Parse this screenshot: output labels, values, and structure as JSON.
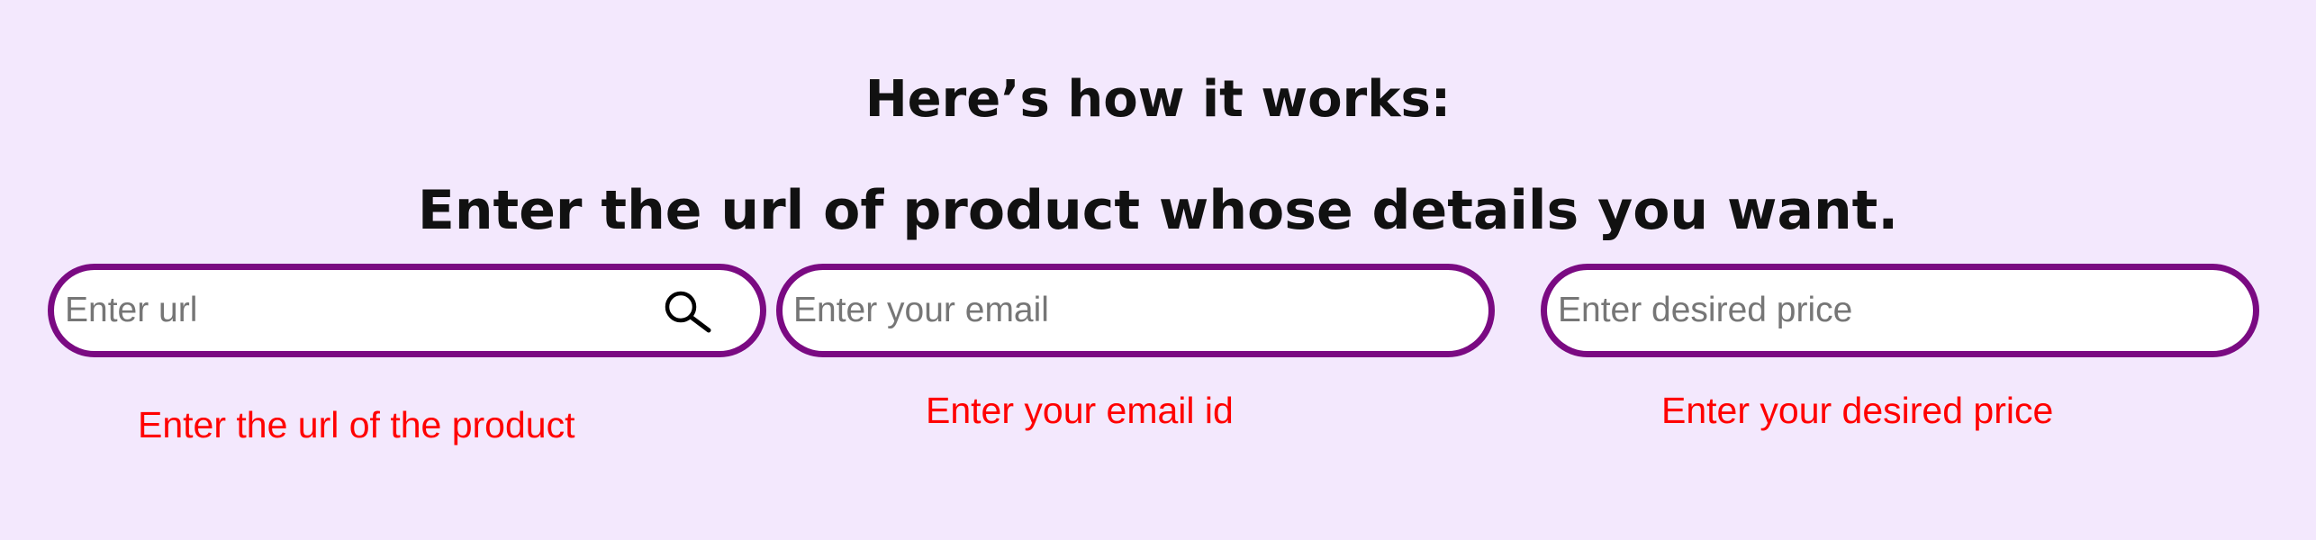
{
  "header": {
    "title": "Here’s how it works:",
    "instruction": "Enter the url of product whose details you want."
  },
  "fields": {
    "url": {
      "placeholder": "Enter url",
      "value": "",
      "icon": "search-icon",
      "error": "Enter the url of the product"
    },
    "email": {
      "placeholder": "Enter your email",
      "value": "",
      "error": "Enter your email id"
    },
    "price": {
      "placeholder": "Enter desired price",
      "value": "",
      "error": "Enter your desired price"
    }
  },
  "colors": {
    "background": "#f3e8fd",
    "field_border": "#7a0a82",
    "error": "#ff0000"
  }
}
